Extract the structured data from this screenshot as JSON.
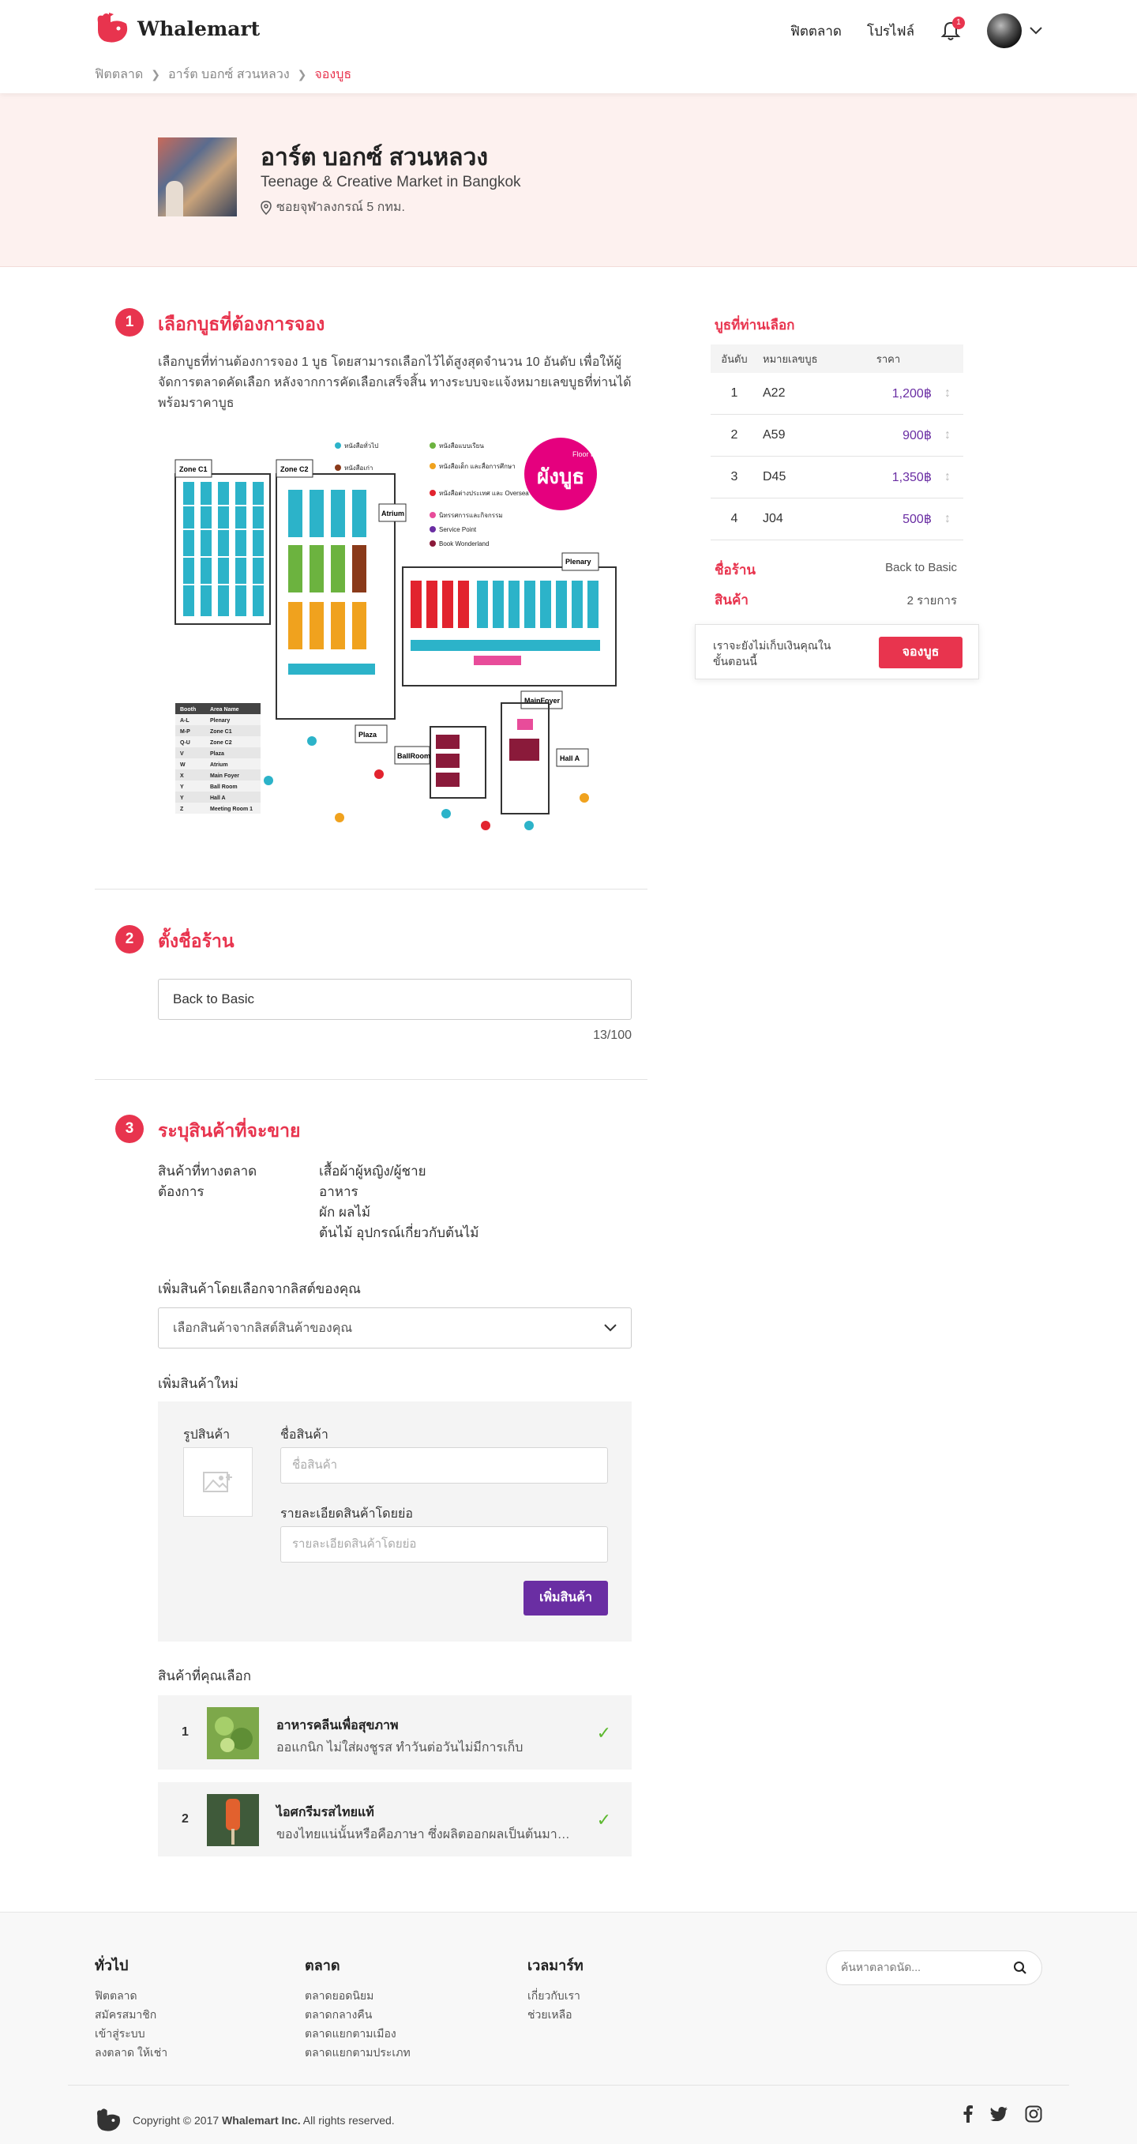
{
  "header": {
    "brand": "Whalemart",
    "nav": [
      "ฟิตตลาด",
      "โปรไฟล์"
    ],
    "notification_count": "1"
  },
  "breadcrumb": [
    "ฟิตตลาด",
    "อาร์ต บอกซ์ สวนหลวง",
    "จองบูธ"
  ],
  "market": {
    "name": "อาร์ต บอกซ์ สวนหลวง",
    "subtitle": "Teenage & Creative Market in Bangkok",
    "location": "ซอยจุฬาลงกรณ์ 5 กทม."
  },
  "step1": {
    "num": "1",
    "title": "เลือกบูธที่ต้องการจอง",
    "description": "เลือกบูธที่ท่านต้องการจอง 1 บูธ โดยสามารถเลือกไว้ได้สูงสุดจำนวน 10 อันดับ เพื่อให้ผู้จัดการตลาดคัดเลือก หลังจากการคัดเลือกเสร็จสิ้น ทางระบบจะแจ้งหมายเลขบูธที่ท่านได้ พร้อมราคาบูธ"
  },
  "floorplan": {
    "badge_top": "Floor Plan",
    "badge_main": "ผังบูธ",
    "zones": [
      "Zone C1",
      "Zone C2",
      "Atrium",
      "Plenary",
      "MainFoyer",
      "Plaza",
      "BallRoom",
      "Hall A"
    ],
    "legend": [
      {
        "label": "หนังสือทั่วไป",
        "color": "#2cb3c9"
      },
      {
        "label": "หนังสือเก่า",
        "color": "#8a3a1a"
      },
      {
        "label": "หนังสือแบบเรียน",
        "color": "#6cb33f"
      },
      {
        "label": "หนังสือเด็ก และสื่อการศึกษา",
        "color": "#f0a21e"
      },
      {
        "label": "หนังสือต่างประเทศ และ Oversea",
        "color": "#e2232e"
      },
      {
        "label": "นิทรรศการและกิจกรรม",
        "color": "#e84c9a"
      },
      {
        "label": "Service Point",
        "color": "#6a2ea3"
      },
      {
        "label": "Book Wonderland",
        "color": "#8a1a3a"
      }
    ],
    "table_headers": [
      "Booth",
      "Area Name"
    ],
    "table_rows": [
      [
        "A-L",
        "Plenary"
      ],
      [
        "M-P",
        "Zone C1"
      ],
      [
        "Q-U",
        "Zone C2"
      ],
      [
        "V",
        "Plaza"
      ],
      [
        "W",
        "Atrium"
      ],
      [
        "X",
        "Main Foyer"
      ],
      [
        "Y",
        "Ball Room"
      ],
      [
        "Y",
        "Hall A"
      ],
      [
        "Z",
        "Meeting Room 1"
      ]
    ]
  },
  "step2": {
    "num": "2",
    "title": "ตั้งชื่อร้าน",
    "shop_name": "Back to Basic",
    "counter": "13/100"
  },
  "step3": {
    "num": "3",
    "title": "ระบุสินค้าที่จะขาย",
    "wanted_label": "สินค้าที่ทางตลาดต้องการ",
    "wanted_items": [
      "เสื้อผ้าผู้หญิง/ผู้ชาย",
      "อาหาร",
      "ผัก ผลไม้",
      "ต้นไม้ อุปกรณ์เกี่ยวกับต้นไม้"
    ],
    "from_list_label": "เพิ่มสินค้าโดยเลือกจากลิสต์ของคุณ",
    "select_placeholder": "เลือกสินค้าจากลิสต์สินค้าของคุณ",
    "new_product_label": "เพิ่มสินค้าใหม่",
    "image_label": "รูปสินค้า",
    "name_label": "ชื่อสินค้า",
    "name_placeholder": "ชื่อสินค้า",
    "detail_label": "รายละเอียดสินค้าโดยย่อ",
    "detail_placeholder": "รายละเอียดสินค้าโดยย่อ",
    "add_button": "เพิ่มสินค้า",
    "selected_label": "สินค้าที่คุณเลือก",
    "selected": [
      {
        "index": "1",
        "name": "อาหารคลีนเพื่อสุขภาพ",
        "desc": "ออแกนิก ไม่ใส่ผงชูรส ทำวันต่อวันไม่มีการเก็บ"
      },
      {
        "index": "2",
        "name": "ไอศกรีมรสไทยแท้",
        "desc": "ของไทยแน่นั้นหรือคือภาษา ซึ่งผลิตออกผลเป็นต้นมาจากธรรมชาติ"
      }
    ]
  },
  "sidebar": {
    "title": "บูธที่ท่านเลือก",
    "headers": [
      "อันดับ",
      "หมายเลขบูธ",
      "ราคา"
    ],
    "rows": [
      {
        "rank": "1",
        "booth": "A22",
        "price": "1,200฿"
      },
      {
        "rank": "2",
        "booth": "A59",
        "price": "900฿"
      },
      {
        "rank": "3",
        "booth": "D45",
        "price": "1,350฿"
      },
      {
        "rank": "4",
        "booth": "J04",
        "price": "500฿"
      }
    ],
    "shop_label": "ชื่อร้าน",
    "shop_value": "Back to Basic",
    "product_label": "สินค้า",
    "product_value": "2 รายการ",
    "reserve_note": "เราจะยังไม่เก็บเงินคุณในขั้นตอนนี้",
    "reserve_button": "จองบูธ"
  },
  "footer": {
    "col1": {
      "title": "ทั่วไป",
      "links": [
        "ฟิตตลาด",
        "สมัครสมาชิก",
        "เข้าสู่ระบบ",
        "ลงตลาด ให้เช่า"
      ]
    },
    "col2": {
      "title": "ตลาด",
      "links": [
        "ตลาดยอดนิยม",
        "ตลาดกลางคืน",
        "ตลาดแยกตามเมือง",
        "ตลาดแยกตามประเภท"
      ]
    },
    "col3": {
      "title": "เวลมาร์ท",
      "links": [
        "เกี่ยวกับเรา",
        "ช่วยเหลือ"
      ]
    },
    "search_placeholder": "ค้นหาตลาดนัด...",
    "copyright_pre": "Copyright © 2017 ",
    "copyright_brand": "Whalemart Inc.",
    "copyright_post": " All rights reserved."
  },
  "colors": {
    "accent": "#e8344e",
    "purple": "#6a2ea3",
    "success": "#5cb82e"
  }
}
